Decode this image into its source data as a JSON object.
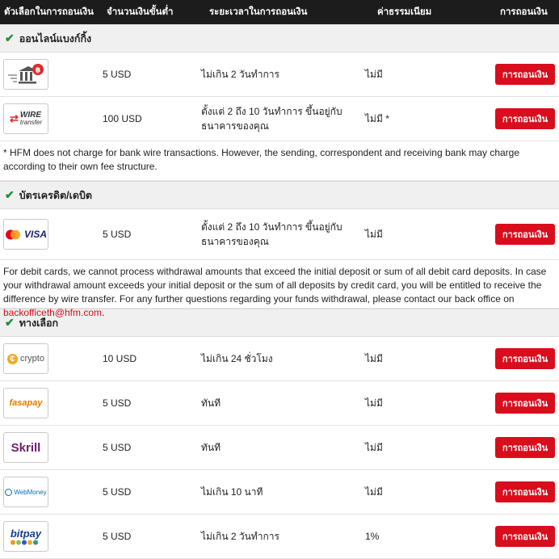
{
  "header": {
    "option": "ตัวเลือกในการถอนเงิน",
    "min_amount": "จำนวนเงินขั้นต่ำ",
    "time": "ระยะเวลาในการถอนเงิน",
    "fee": "ค่าธรรมเนียม",
    "withdraw": "การถอนเงิน"
  },
  "button_label": "การถอนเงิน",
  "colors": {
    "accent": "#d90d1c",
    "check": "#1a8f3a",
    "header_bg": "#1c1c1c"
  },
  "sections": {
    "online_banking": {
      "title": "ออนไลน์แบงก์กิ้ง",
      "rows": [
        {
          "logo": "bank-transfer-icon",
          "min": "5 USD",
          "time": "ไม่เกิน 2 วันทำการ",
          "fee": "ไม่มี"
        },
        {
          "logo_text_1": "WIRE",
          "logo_text_2": "transfer",
          "min": "100 USD",
          "time": "ตั้งแต่ 2 ถึง 10 วันทำการ ขึ้นอยู่กับธนาคารของคุณ",
          "fee": "ไม่มี *"
        }
      ],
      "note": "* HFM does not charge for bank wire transactions. However, the sending, correspondent and receiving bank may charge according to their own fee structure."
    },
    "cards": {
      "title": "บัตรเครดิต/เดบิต",
      "rows": [
        {
          "logo_text": "VISA",
          "min": "5 USD",
          "time": "ตั้งแต่ 2 ถึง 10 วันทำการ ขึ้นอยู่กับธนาคารของคุณ",
          "fee": "ไม่มี"
        }
      ],
      "note_text": "For debit cards, we cannot process withdrawal amounts that exceed the initial deposit or sum of all debit card deposits. In case your withdrawal amount exceeds your initial deposit or the sum of all deposits by credit card, you will be entitled to receive the difference by wire transfer. For any further questions regarding your funds withdrawal, please contact our back office on ",
      "note_link": "backofficeth@hfm.com",
      "note_end": "."
    },
    "alternatives": {
      "title": "ทางเลือก",
      "rows": [
        {
          "logo_text": "crypto",
          "min": "10 USD",
          "time": "ไม่เกิน 24 ชั่วโมง",
          "fee": "ไม่มี"
        },
        {
          "logo_text": "fasapay",
          "min": "5 USD",
          "time": "ทันที",
          "fee": "ไม่มี"
        },
        {
          "logo_text": "Skrill",
          "min": "5 USD",
          "time": "ทันที",
          "fee": "ไม่มี"
        },
        {
          "logo_text": "WebMoney",
          "min": "5 USD",
          "time": "ไม่เกิน 10 นาที",
          "fee": "ไม่มี"
        },
        {
          "logo_text": "bitpay",
          "min": "5 USD",
          "time": "ไม่เกิน 2 วันทำการ",
          "fee": "1%"
        }
      ]
    }
  }
}
